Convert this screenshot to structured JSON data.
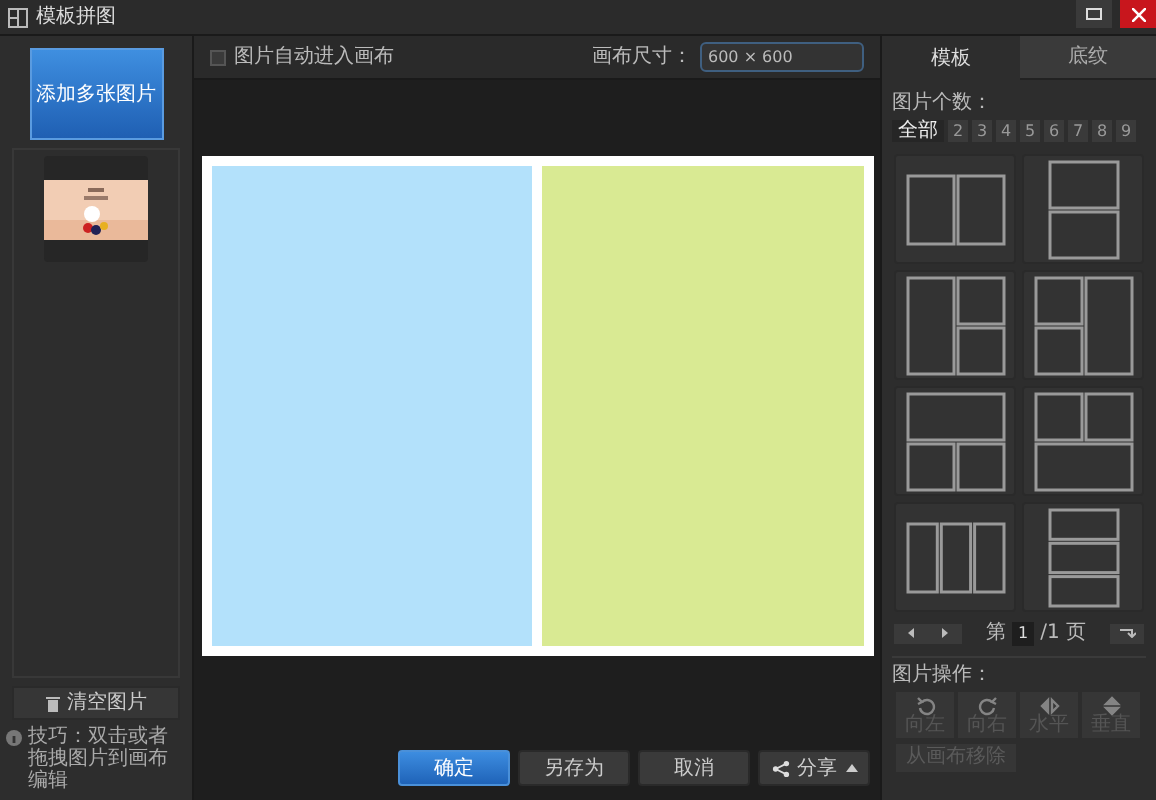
{
  "window": {
    "title": "模板拼图"
  },
  "left": {
    "add_button": "添加多张图片",
    "clear_button": "清空图片",
    "tip": "技巧：双击或者拖拽图片到画布编辑"
  },
  "toolbar": {
    "auto_canvas": {
      "label": "图片自动进入画布",
      "checked": false
    },
    "size_label": "画布尺寸：",
    "size_value": "600 × 600"
  },
  "canvas": {
    "slots": [
      {
        "color": "#b3e1fb"
      },
      {
        "color": "#d9ea93"
      }
    ]
  },
  "bottom_buttons": [
    {
      "label": "确定",
      "kind": "primary"
    },
    {
      "label": "另存为",
      "kind": "normal"
    },
    {
      "label": "取消",
      "kind": "normal"
    },
    {
      "label": "分享",
      "kind": "share"
    }
  ],
  "tabs": [
    {
      "label": "模板",
      "selected": true
    },
    {
      "label": "底纹",
      "selected": false
    }
  ],
  "count_label": "图片个数：",
  "counts": [
    {
      "label": "全部",
      "selected": true
    },
    {
      "label": "2",
      "selected": false
    },
    {
      "label": "3",
      "selected": false
    },
    {
      "label": "4",
      "selected": false
    },
    {
      "label": "5",
      "selected": false
    },
    {
      "label": "6",
      "selected": false
    },
    {
      "label": "7",
      "selected": false
    },
    {
      "label": "8",
      "selected": false
    },
    {
      "label": "9",
      "selected": false
    }
  ],
  "pager": {
    "prefix": "第",
    "page": "1",
    "suffix": "/1 页"
  },
  "ops_label": "图片操作：",
  "ops": [
    {
      "label": "向左",
      "kind": "rotate-left",
      "disabled": true
    },
    {
      "label": "向右",
      "kind": "rotate-right",
      "disabled": true
    },
    {
      "label": "水平",
      "kind": "flip-h",
      "disabled": true
    },
    {
      "label": "垂直",
      "kind": "flip-v",
      "disabled": true
    }
  ],
  "remove_button": {
    "label": "从画布移除",
    "disabled": true
  }
}
